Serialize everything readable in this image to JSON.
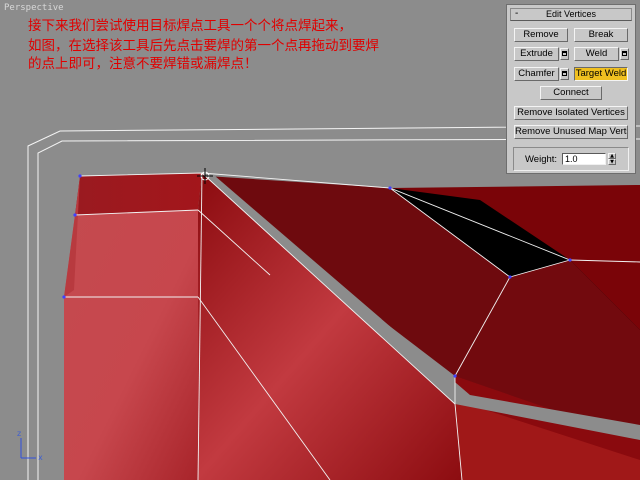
{
  "viewport": {
    "label": "Perspective",
    "axis_x": "x",
    "axis_z": "z"
  },
  "caption": {
    "line1": "接下来我们尝试使用目标焊点工具一个个将点焊起来，",
    "line2": "如图，在选择该工具后先点击要焊的第一个点再拖动到要焊",
    "line3": "的点上即可，注意不要焊错或漏焊点！"
  },
  "rollout": {
    "title": "Edit Vertices",
    "collapse_symbol": "-",
    "remove": "Remove",
    "break": "Break",
    "extrude": "Extrude",
    "weld": "Weld",
    "chamfer": "Chamfer",
    "target_weld": "Target Weld",
    "connect": "Connect",
    "remove_isolated": "Remove Isolated Vertices",
    "remove_unused": "Remove Unused Map Verts",
    "weight_label": "Weight:",
    "weight_value": "1.0",
    "active_tool": "Target Weld"
  },
  "colors": {
    "viewport_bg": "#8c8c8c",
    "caption": "#e00000",
    "active_button": "#f0c020"
  }
}
